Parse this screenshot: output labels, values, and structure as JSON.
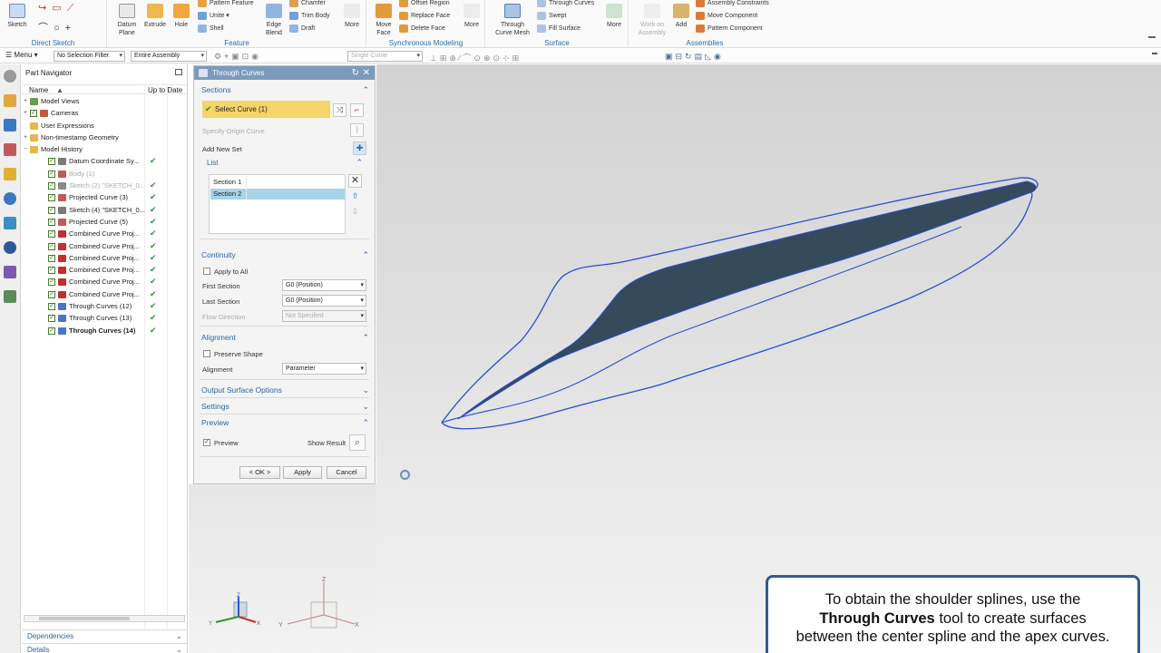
{
  "ribbon": {
    "groups": {
      "direct_sketch": "Direct Sketch",
      "feature": "Feature",
      "synchronous": "Synchronous Modeling",
      "surface": "Surface",
      "assemblies": "Assemblies"
    },
    "sketch": "Sketch",
    "datum_plane": "Datum\nPlane",
    "extrude": "Extrude",
    "hole": "Hole",
    "pattern_feature": "Pattern Feature",
    "unite": "Unite",
    "shell": "Shell",
    "chamfer": "Chamfer",
    "trim_body": "Trim Body",
    "draft": "Draft",
    "edge_blend": "Edge\nBlend",
    "more": "More",
    "move_face": "Move\nFace",
    "offset_region": "Offset Region",
    "replace_face": "Replace Face",
    "delete_face": "Delete Face",
    "through_curve_mesh": "Through\nCurve Mesh",
    "through_curves": "Through Curves",
    "swept": "Swept",
    "fill_surface": "Fill Surface",
    "work_on_assembly": "Work on\nAssembly",
    "add": "Add",
    "assembly_constraints": "Assembly Constraints",
    "move_component": "Move Component",
    "pattern_component": "Pattern Component"
  },
  "cmdbar": {
    "menu": "Menu",
    "selection_filter": "No Selection Filter",
    "scope": "Entire Assembly",
    "curve_rule": "Single Curve"
  },
  "navigator": {
    "title": "Part Navigator",
    "col_name": "Name",
    "col_uptodate": "Up to Date",
    "items": [
      {
        "label": "Model Views"
      },
      {
        "label": "Cameras"
      },
      {
        "label": "User Expressions"
      },
      {
        "label": "Non-timestamp Geometry"
      },
      {
        "label": "Model History"
      },
      {
        "label": "Datum Coordinate Sy..."
      },
      {
        "label": "Body (1)"
      },
      {
        "label": "Sketch (2) \"SKETCH_0..."
      },
      {
        "label": "Projected Curve (3)"
      },
      {
        "label": "Sketch (4) \"SKETCH_0..."
      },
      {
        "label": "Projected Curve (5)"
      },
      {
        "label": "Combined Curve Proj..."
      },
      {
        "label": "Combined Curve Proj..."
      },
      {
        "label": "Combined Curve Proj..."
      },
      {
        "label": "Combined Curve Proj..."
      },
      {
        "label": "Combined Curve Proj..."
      },
      {
        "label": "Combined Curve Proj..."
      },
      {
        "label": "Through Curves (12)"
      },
      {
        "label": "Through Curves (13)"
      },
      {
        "label": "Through Curves (14)"
      }
    ],
    "dependencies": "Dependencies",
    "details": "Details"
  },
  "dialog": {
    "title": "Through Curves",
    "sections": "Sections",
    "select_curve": "Select Curve (1)",
    "specify_origin": "Specify Origin Curve",
    "add_new_set": "Add New Set",
    "list": "List",
    "list_items": [
      "Section  1",
      "Section  2"
    ],
    "continuity": "Continuity",
    "apply_to_all": "Apply to All",
    "first_section": "First Section",
    "first_section_value": "G0 (Position)",
    "last_section": "Last Section",
    "last_section_value": "G0 (Position)",
    "flow_direction": "Flow Direction",
    "flow_direction_value": "Not Specified",
    "alignment_group": "Alignment",
    "preserve_shape": "Preserve Shape",
    "alignment": "Alignment",
    "alignment_value": "Parameter",
    "output_surface_options": "Output Surface Options",
    "settings": "Settings",
    "preview_group": "Preview",
    "preview": "Preview",
    "show_result": "Show Result",
    "ok": "< OK >",
    "apply": "Apply",
    "cancel": "Cancel"
  },
  "callout": {
    "line1": "To obtain the shoulder splines, use the",
    "bold": "Through Curves",
    "line2_rest": " tool to create surfaces",
    "line3": "between the center spline and the apex curves."
  },
  "triad": {
    "x": "X",
    "y": "Y",
    "z": "Z"
  },
  "colors": {
    "accent": "#2d64a8",
    "selection": "#f5d46a",
    "surface": "#354a5a",
    "curve": "#2a4fd0"
  }
}
